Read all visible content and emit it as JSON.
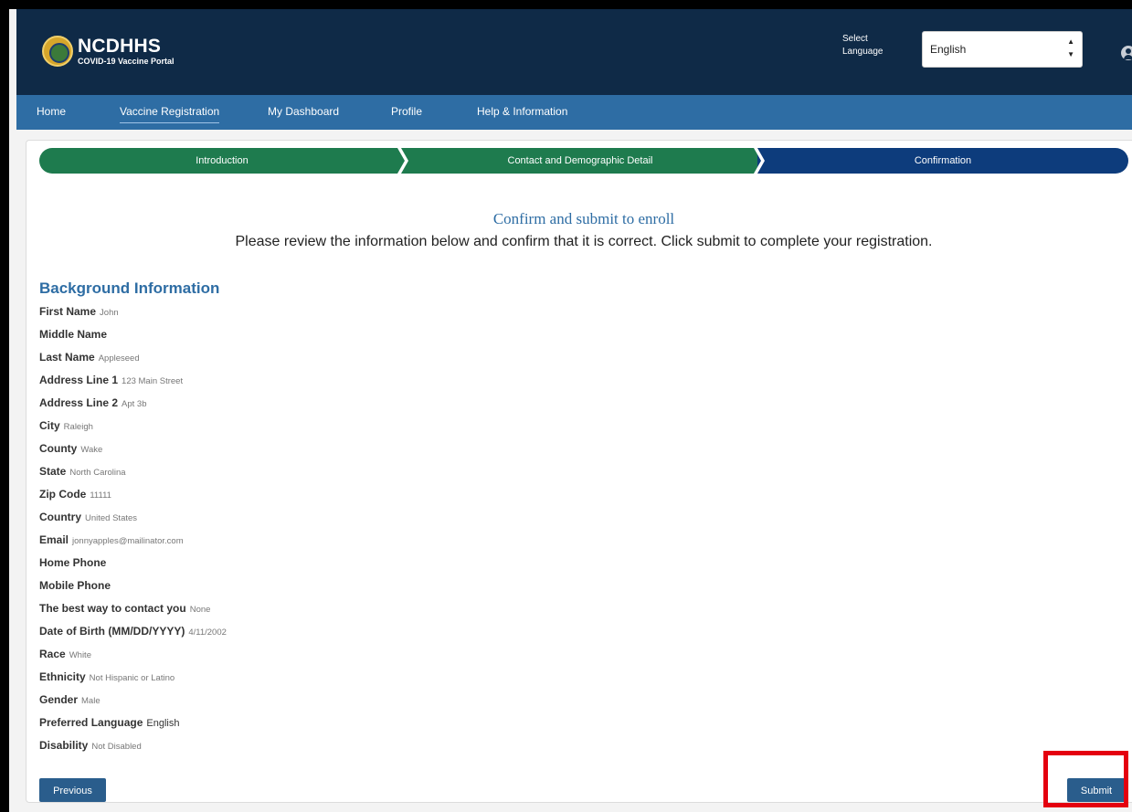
{
  "header": {
    "brand_title": "NCDHHS",
    "brand_subtitle": "COVID-19 Vaccine Portal",
    "logo_icon": "ncdhhs-seal-logo",
    "language_label": "Select Language",
    "language_value": "English",
    "user_icon": "user-avatar-icon"
  },
  "nav": {
    "items": [
      {
        "label": "Home"
      },
      {
        "label": "Vaccine Registration",
        "active": true
      },
      {
        "label": "My Dashboard"
      },
      {
        "label": "Profile"
      },
      {
        "label": "Help & Information"
      }
    ]
  },
  "steps": [
    {
      "label": "Introduction",
      "color": "#1e7b4e"
    },
    {
      "label": "Contact and Demographic Detail",
      "color": "#1e7b4e"
    },
    {
      "label": "Confirmation",
      "color": "#0d3c7c"
    }
  ],
  "main": {
    "heading": "Confirm and submit to enroll",
    "subheading": "Please review the information below and confirm that it is correct. Click submit to complete your registration.",
    "section_title": "Background Information",
    "fields": [
      {
        "label": "First Name",
        "value": "John"
      },
      {
        "label": "Middle Name",
        "value": ""
      },
      {
        "label": "Last Name",
        "value": "Appleseed"
      },
      {
        "label": "Address Line 1",
        "value": "123 Main Street"
      },
      {
        "label": "Address Line 2",
        "value": "Apt 3b"
      },
      {
        "label": "City",
        "value": "Raleigh"
      },
      {
        "label": "County",
        "value": "Wake"
      },
      {
        "label": "State",
        "value": "North Carolina"
      },
      {
        "label": "Zip Code",
        "value": "11111"
      },
      {
        "label": "Country",
        "value": "United States"
      },
      {
        "label": "Email",
        "value": "jonnyapples@mailinator.com"
      },
      {
        "label": "Home Phone",
        "value": ""
      },
      {
        "label": "Mobile Phone",
        "value": ""
      },
      {
        "label": "The best way to contact you",
        "value": "None"
      },
      {
        "label": "Date of Birth (MM/DD/YYYY)",
        "value": "4/11/2002"
      },
      {
        "label": "Race",
        "value": "White"
      },
      {
        "label": "Ethnicity",
        "value": "Not Hispanic or Latino"
      },
      {
        "label": "Gender",
        "value": "Male"
      },
      {
        "label": "Preferred Language",
        "value": "English",
        "dark": true
      },
      {
        "label": "Disability",
        "value": "Not Disabled"
      }
    ],
    "previous_label": "Previous",
    "submit_label": "Submit"
  },
  "colors": {
    "header_bg": "#0f2a47",
    "nav_bg": "#2e6da4",
    "step_done": "#1e7b4e",
    "step_active": "#0d3c7c",
    "button_bg": "#2a5d8c",
    "highlight": "#e4000f"
  }
}
